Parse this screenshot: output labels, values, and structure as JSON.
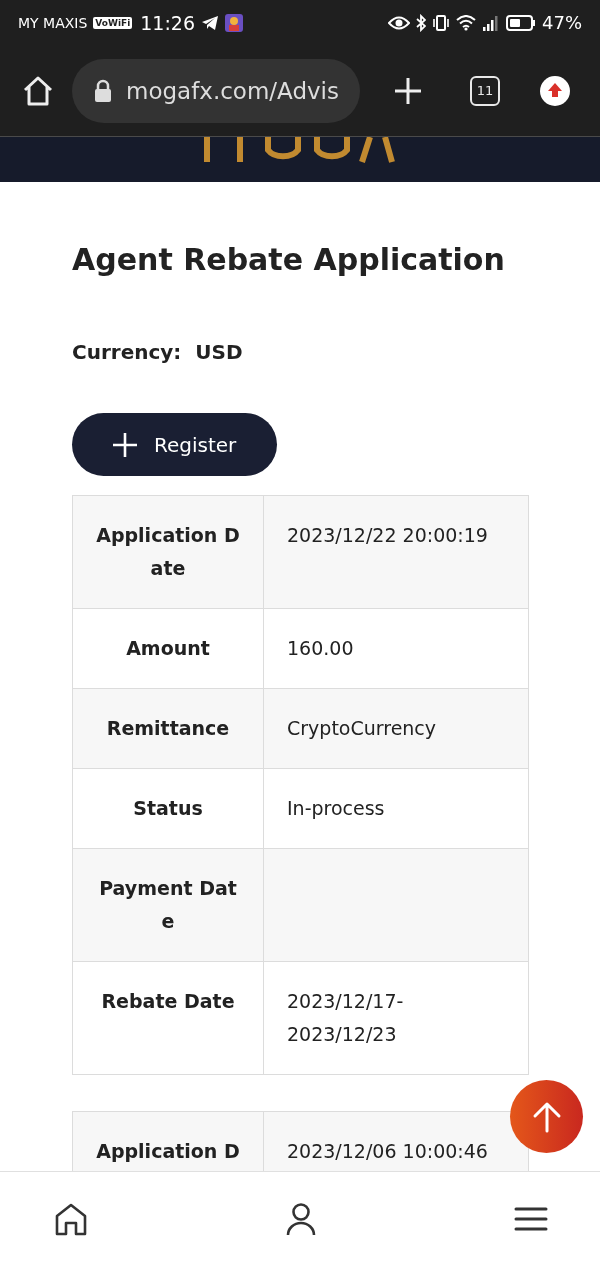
{
  "status_bar": {
    "carrier": "MY MAXIS",
    "call_badge": "VoWiFi",
    "time": "11:26",
    "battery": "47%"
  },
  "browser": {
    "url": "mogafx.com/Advis",
    "tab_count": "11"
  },
  "page": {
    "title": "Agent Rebate Application",
    "currency_label": "Currency:",
    "currency": "USD",
    "register_button": "Register"
  },
  "records": [
    {
      "rows": [
        {
          "label": "Application Date",
          "value": "2023/12/22 20:00:19"
        },
        {
          "label": "Amount",
          "value": "160.00"
        },
        {
          "label": "Remittance",
          "value": "CryptoCurrency"
        },
        {
          "label": "Status",
          "value": "In-process"
        },
        {
          "label": "Payment Date",
          "value": ""
        },
        {
          "label": "Rebate Date",
          "value": "2023/12/17-2023/12/23"
        }
      ]
    },
    {
      "rows": [
        {
          "label": "Application D",
          "value": "2023/12/06 10:00:46"
        }
      ]
    }
  ]
}
